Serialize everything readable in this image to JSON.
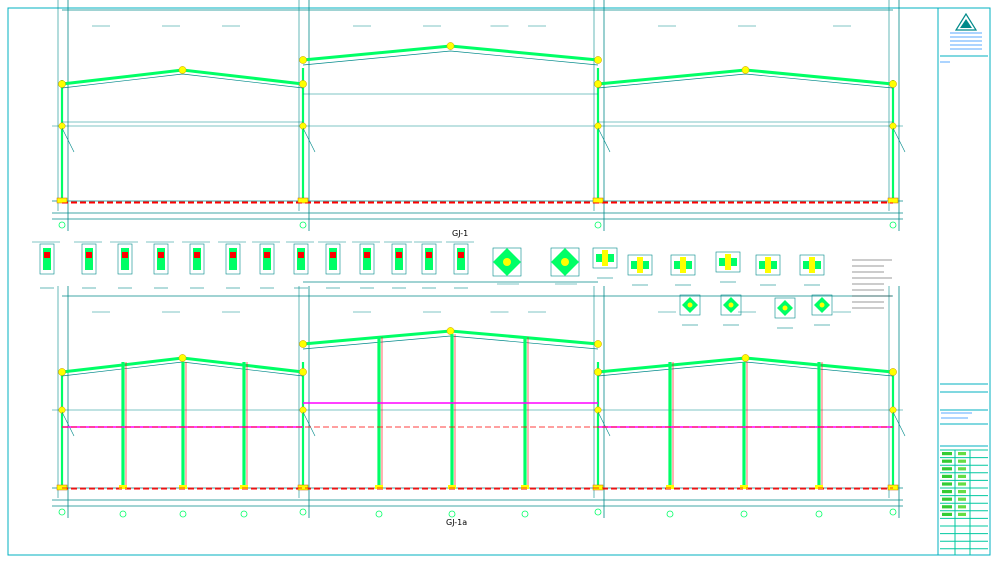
{
  "drawing": {
    "frame_title_1": "GJ-1",
    "frame_title_2": "GJ-1a",
    "colors": {
      "frame": "#00ff66",
      "line": "#008a8a",
      "red": "#ff0000",
      "magenta": "#ff00ff",
      "yellow": "#ffff00",
      "border": "#00b0c0",
      "text": "#000000"
    }
  },
  "title_block": {
    "logo_icon": "company-logo-icon"
  }
}
